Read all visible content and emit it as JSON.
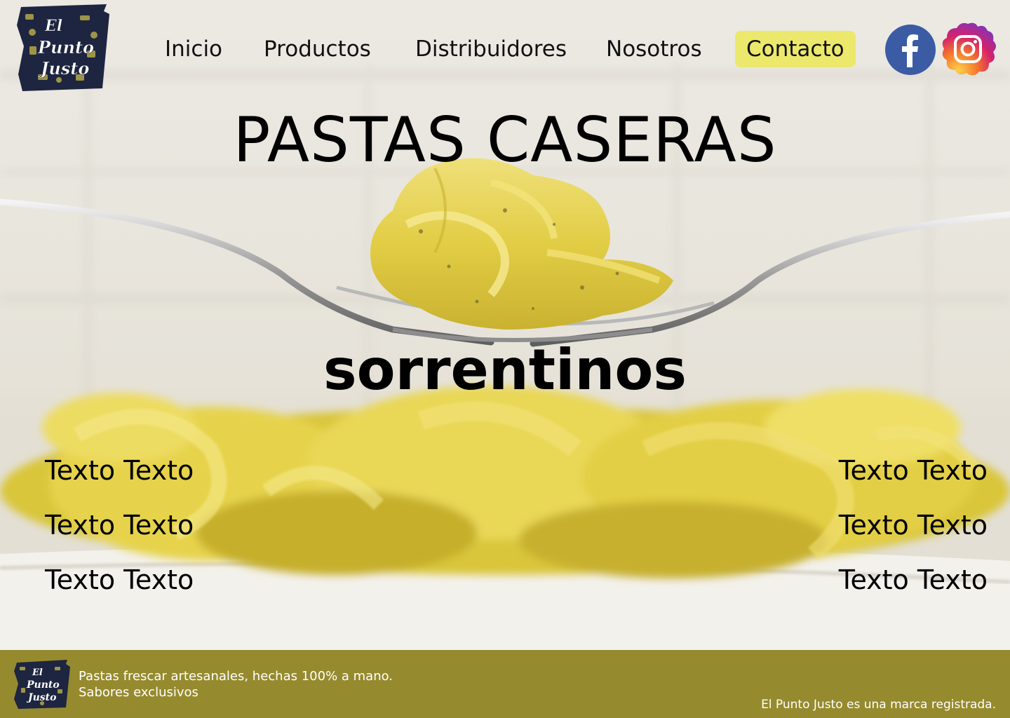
{
  "logo": {
    "line1": "El",
    "line2": "Punto",
    "line3": "Justo"
  },
  "nav": [
    {
      "label": "Inicio",
      "active": false
    },
    {
      "label": "Productos",
      "active": false
    },
    {
      "label": "Distribuidores",
      "active": false
    },
    {
      "label": "Nosotros",
      "active": false
    },
    {
      "label": "Contacto",
      "active": true
    }
  ],
  "colors": {
    "nav_active": "#ece86c",
    "footer_bg": "#968a2e",
    "facebook": "#3b5ba5",
    "pasta": "#e3d24a"
  },
  "social": [
    {
      "icon": "facebook-icon"
    },
    {
      "icon": "instagram-icon"
    }
  ],
  "hero": {
    "title": "PASTAS CASERAS",
    "subtitle": "sorrentinos",
    "left_texts": [
      "Texto Texto",
      "Texto Texto",
      "Texto Texto"
    ],
    "right_texts": [
      "Texto Texto",
      "Texto Texto",
      "Texto Texto"
    ]
  },
  "footer": {
    "description_line1": "Pastas frescar artesanales, hechas 100% a mano.",
    "description_line2": "Sabores exclusivos",
    "legal": "El Punto Justo es una marca registrada."
  }
}
